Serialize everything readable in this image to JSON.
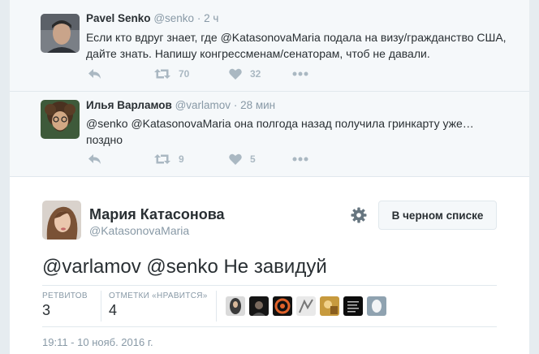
{
  "ancestors": [
    {
      "fullname": "Pavel Senko",
      "username": "@senko",
      "dot": "·",
      "time": "2 ч",
      "text": "Если кто вдруг знает, где @KatasonovaMaria подала на визу/гражданство США, дайте знать. Напишу конгрессменам/сенаторам, чтоб не давали.",
      "retweets": "70",
      "likes": "32"
    },
    {
      "fullname": "Илья Варламов",
      "username": "@varlamov",
      "dot": "·",
      "time": "28 мин",
      "text": "@senko @KatasonovaMaria она полгода назад получила гринкарту уже… поздно",
      "retweets": "9",
      "likes": "5"
    }
  ],
  "main": {
    "fullname": "Мария Катасонова",
    "username": "@KatasonovaMaria",
    "follow_label": "В черном списке",
    "text": "@varlamov @senko Не завидуй",
    "retweets_label": "РЕТВИТОВ",
    "retweets": "3",
    "likes_label": "ОТМЕТКИ «НРАВИТСЯ»",
    "likes": "4",
    "date": "19:11 - 10 нояб. 2016 г."
  },
  "colors": {
    "background": "#e6ecf0",
    "ancestor_bg": "#f5f8fa",
    "muted": "#8899a6",
    "action_gray": "#aab8c2",
    "text": "#292f33",
    "border": "#e1e8ed"
  },
  "icons": [
    "reply-icon",
    "retweet-icon",
    "like-icon",
    "more-icon",
    "gear-icon"
  ]
}
